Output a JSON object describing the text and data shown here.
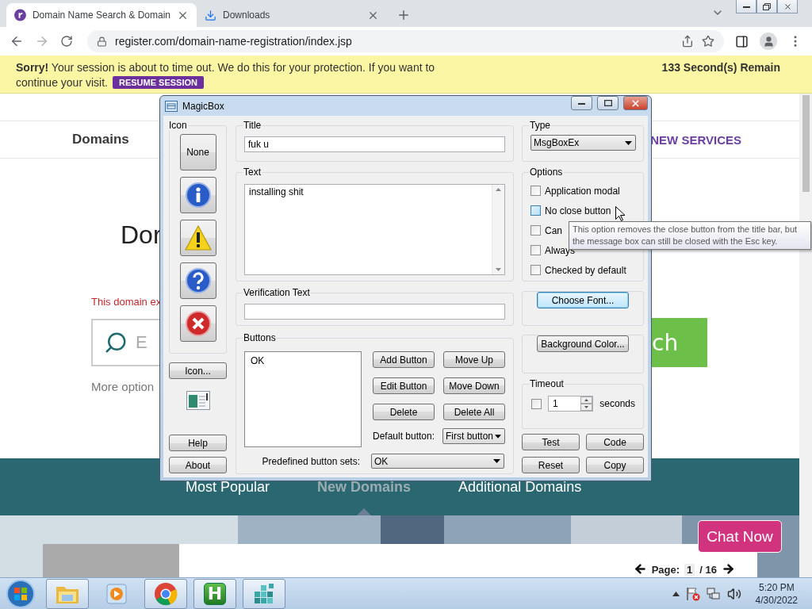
{
  "browser": {
    "tabs": [
      {
        "title": "Domain Name Search & Domain",
        "selected": true
      },
      {
        "title": "Downloads",
        "selected": false
      }
    ],
    "url": "register.com/domain-name-registration/index.jsp"
  },
  "session_banner": {
    "message": "**Sorry!** Your session is about to time out. We do this for your protection. If you want to continue your visit.",
    "button": "RESUME SESSION",
    "countdown": "133 Second(s) Remain"
  },
  "page": {
    "nav": [
      "Domains",
      "NEW SERVICES"
    ],
    "heading": "Dor",
    "notice": "This domain ex",
    "search_placeholder": "E",
    "search_button": "ch",
    "more_options": "More option",
    "category_tabs": [
      {
        "label": "Most Popular",
        "selected": false
      },
      {
        "label": "New Domains",
        "selected": true
      },
      {
        "label": "Additional Domains",
        "selected": false
      }
    ],
    "chat_button": "Chat Now",
    "pagination": {
      "label": "Page:",
      "current": "1",
      "total": "/ 16"
    }
  },
  "dialog": {
    "title": "MagicBox",
    "icon_group": {
      "label": "Icon",
      "icons": [
        {
          "kind": "none",
          "label": "None"
        },
        {
          "kind": "info"
        },
        {
          "kind": "warning"
        },
        {
          "kind": "question"
        },
        {
          "kind": "error"
        }
      ]
    },
    "icon_button": "Icon...",
    "help_button": "Help",
    "about_button": "About",
    "title_group": {
      "label": "Title",
      "value": "fuk u"
    },
    "text_group": {
      "label": "Text",
      "value": "installing shit"
    },
    "verification_group": {
      "label": "Verification Text"
    },
    "buttons_group": {
      "label": "Buttons",
      "items": [
        "OK"
      ],
      "actions": [
        "Add Button",
        "Move Up",
        "Edit Button",
        "Move Down",
        "Delete",
        "Delete All"
      ],
      "default_label": "Default button:",
      "default_value": "First button",
      "predefined_label": "Predefined button sets:",
      "predefined_value": "OK"
    },
    "type_group": {
      "label": "Type",
      "value": "MsgBoxEx"
    },
    "options_group": {
      "label": "Options",
      "options": [
        {
          "label": "Application modal",
          "checked": false,
          "hovered": false
        },
        {
          "label": "No close button",
          "checked": false,
          "hovered": true
        },
        {
          "label": "Can",
          "checked": false,
          "hovered": false
        },
        {
          "label": "Always",
          "checked": false,
          "hovered": false
        },
        {
          "label": "Checked by default",
          "checked": false,
          "hovered": false
        }
      ]
    },
    "font_button": {
      "label": "Choose Font...",
      "focused": true
    },
    "color_button": {
      "label": "Background Color...",
      "focused": false
    },
    "timeout_group": {
      "label": "Timeout",
      "checked": false,
      "value": "1",
      "unit": "seconds"
    },
    "footer_buttons": [
      "Test",
      "Code",
      "Reset",
      "Copy"
    ]
  },
  "tooltip": "This option removes the close button from the title bar, but the message box can still be closed with the Esc key.",
  "taskbar": {
    "apps": [
      {
        "kind": "folder",
        "active": true
      },
      {
        "kind": "media",
        "active": false
      },
      {
        "kind": "chrome",
        "active": true
      },
      {
        "kind": "letter",
        "label": "H",
        "active": true
      },
      {
        "kind": "cubes",
        "active": true
      }
    ],
    "time": "5:20 PM",
    "date": "4/30/2022"
  }
}
